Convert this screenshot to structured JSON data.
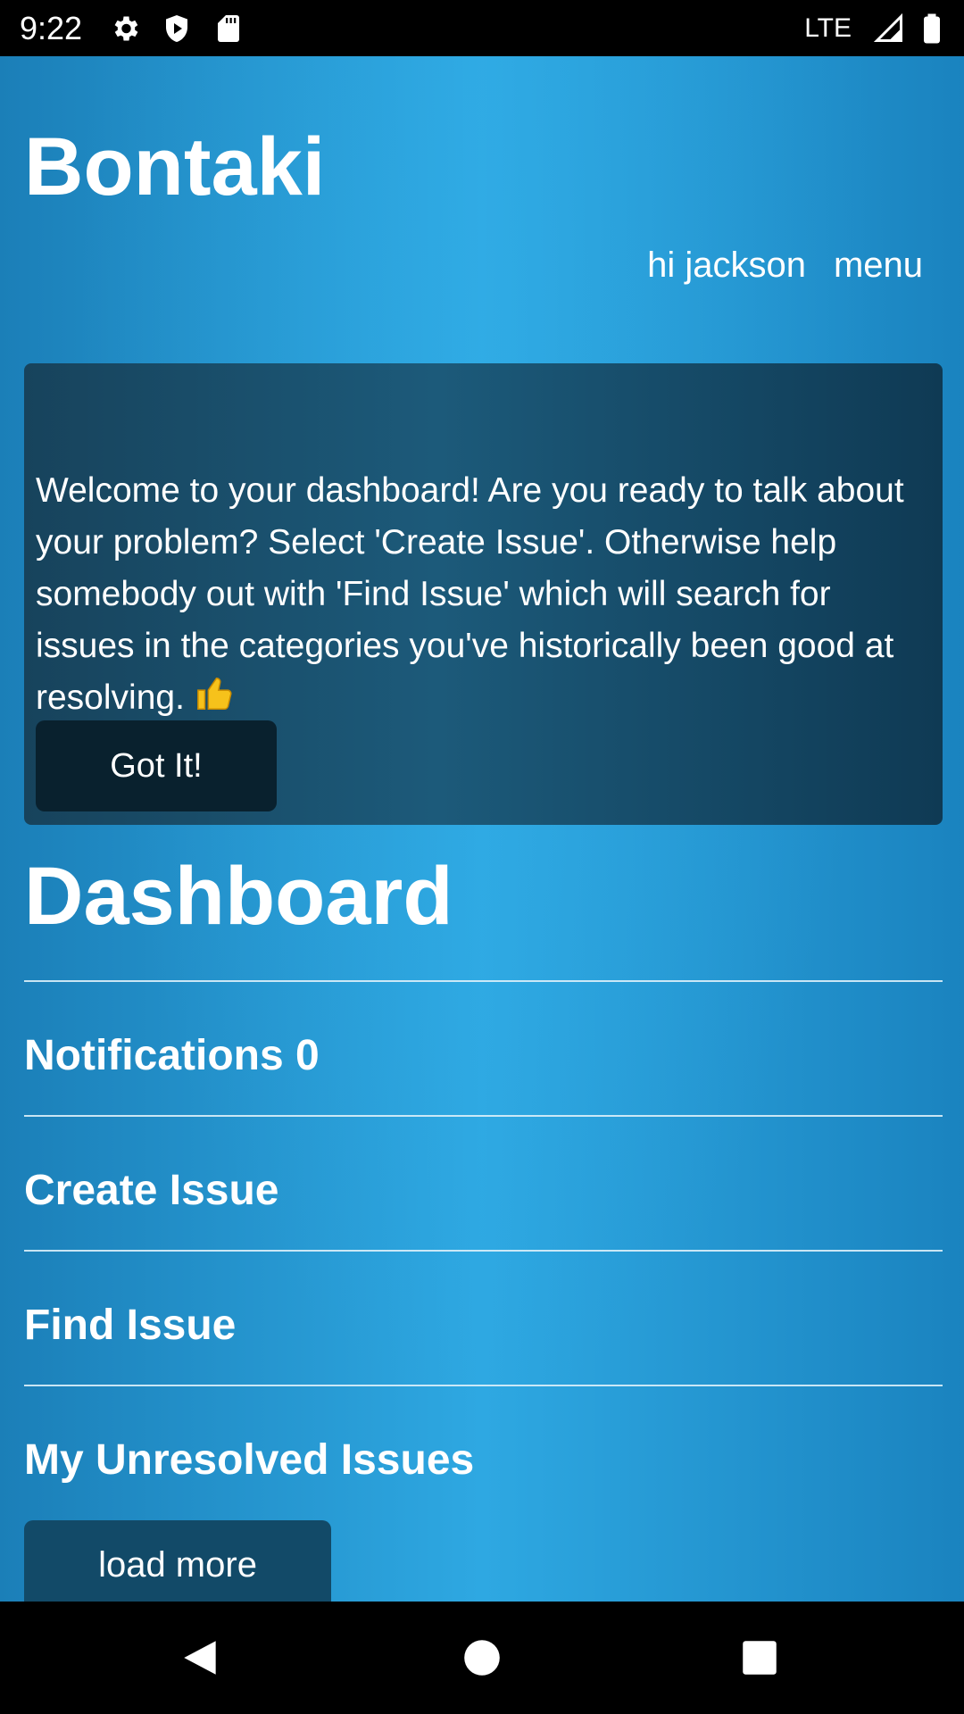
{
  "status_bar": {
    "time": "9:22",
    "network": "LTE",
    "icons": [
      "settings-icon",
      "shield-play-icon",
      "sd-card-icon",
      "signal-icon",
      "battery-icon"
    ]
  },
  "header": {
    "title": "Bontaki",
    "greeting": "hi jackson",
    "menu_label": "menu"
  },
  "welcome_card": {
    "message": "Welcome to your dashboard! Are you ready to talk about your problem? Select 'Create Issue'. Otherwise help somebody out with 'Find Issue' which will search for issues in the categories you've historically been good at resolving.",
    "emoji_icon": "thumbs-up-icon",
    "button_label": "Got It!"
  },
  "dashboard": {
    "title": "Dashboard",
    "items": [
      {
        "label": "Notifications 0"
      },
      {
        "label": "Create Issue"
      },
      {
        "label": "Find Issue"
      },
      {
        "label": "My Unresolved Issues"
      }
    ],
    "load_more_label": "load more"
  },
  "colors": {
    "background_accent": "#2ea8e2",
    "card_background": "#17435c",
    "button_dark": "#09212e",
    "load_more_bg": "#124a68"
  }
}
